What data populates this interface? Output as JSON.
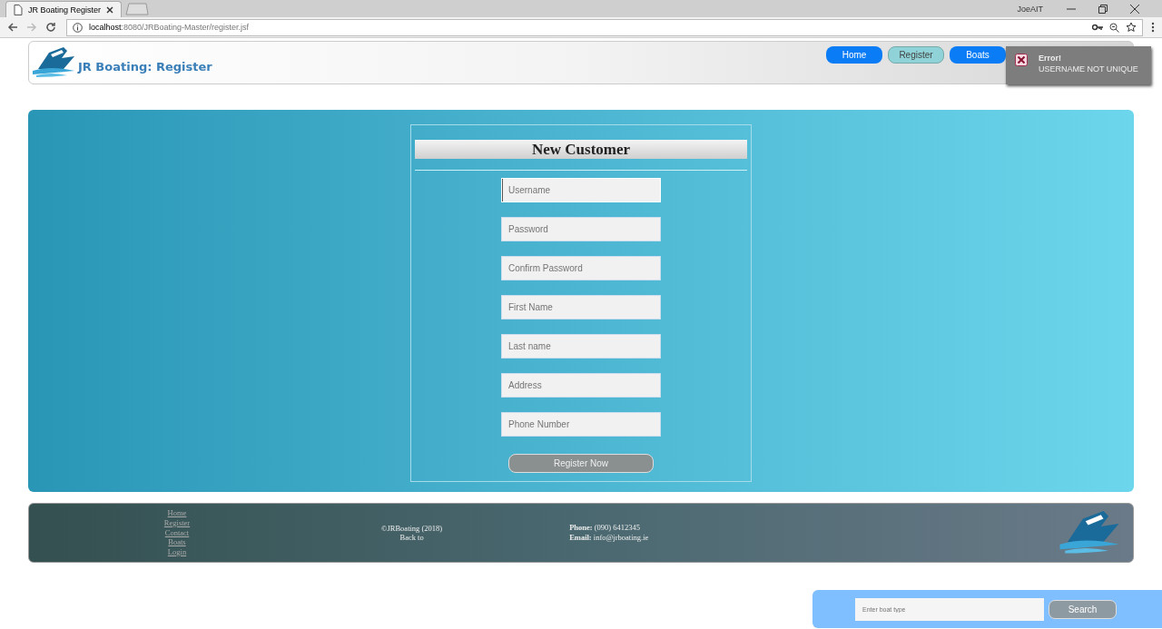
{
  "browser": {
    "tab_title": "JR Boating Register",
    "url_host": "localhost",
    "url_path": ":8080/JRBoating-Master/register.jsf",
    "profile": "JoeAIT"
  },
  "header": {
    "title": "JR Boating: Register"
  },
  "nav": [
    {
      "label": "Home",
      "selected": false
    },
    {
      "label": "Register",
      "selected": true
    },
    {
      "label": "Boats",
      "selected": false
    }
  ],
  "toast": {
    "title": "Error!",
    "message": "USERNAME NOT UNIQUE"
  },
  "form": {
    "title": "New Customer",
    "fields": [
      {
        "placeholder": "Username",
        "focused": true
      },
      {
        "placeholder": "Password",
        "focused": false
      },
      {
        "placeholder": "Confirm Password",
        "focused": false
      },
      {
        "placeholder": "First Name",
        "focused": false
      },
      {
        "placeholder": "Last name",
        "focused": false
      },
      {
        "placeholder": "Address",
        "focused": false
      },
      {
        "placeholder": "Phone Number",
        "focused": false
      }
    ],
    "submit": "Register Now"
  },
  "footer": {
    "links": [
      "Home",
      "Register",
      "Contact",
      "Boats",
      "Login"
    ],
    "copyright": "©JRBoating (2018)",
    "back": "Back to",
    "phone_label": "Phone:",
    "phone": "(090) 6412345",
    "email_label": "Email:",
    "email": "info@jrboating.ie"
  },
  "search": {
    "placeholder": "Enter boat type",
    "button": "Search"
  }
}
